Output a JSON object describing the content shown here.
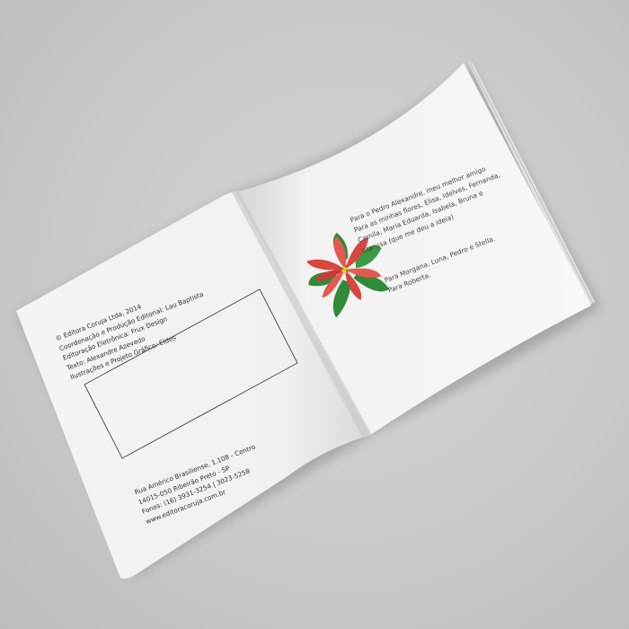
{
  "left_page": {
    "credits": [
      "© Editora Coruja Ltda, 2014",
      "Coordenação e Produção Editorial: Lau Baptista",
      "Editoração Eletrônica: Frux Design",
      "Texto: Alexandre Azevedo",
      "Ilustrações e Projeto Gráfico: Eldes"
    ],
    "address": [
      "Rua Américo Brasiliense, 1.108 - Centro",
      "14015-050 Ribeirão Preto - SP",
      "Fones: (16) 3931-3254 | 3023-5258",
      "www.editoracoruja.com.br"
    ]
  },
  "right_page": {
    "dedication_1": [
      "Para o Pedro Alexandre, meu melhor amigo",
      "Para as minhas flores, Elisa,  Idelves, Fernanda,",
      "Camila, Maria Eduarda, Isabela, Bruna e",
      "Clarissa (que me deu a ideia)"
    ],
    "dedication_2": [
      "Para Morgana, Luna, Pedro e Stella.",
      "Para Roberta."
    ]
  },
  "colors": {
    "background": "#c9c9c9",
    "page": "#f6f6f6",
    "petal_red": "#d9453f",
    "leaf_green": "#2f8a3a"
  }
}
